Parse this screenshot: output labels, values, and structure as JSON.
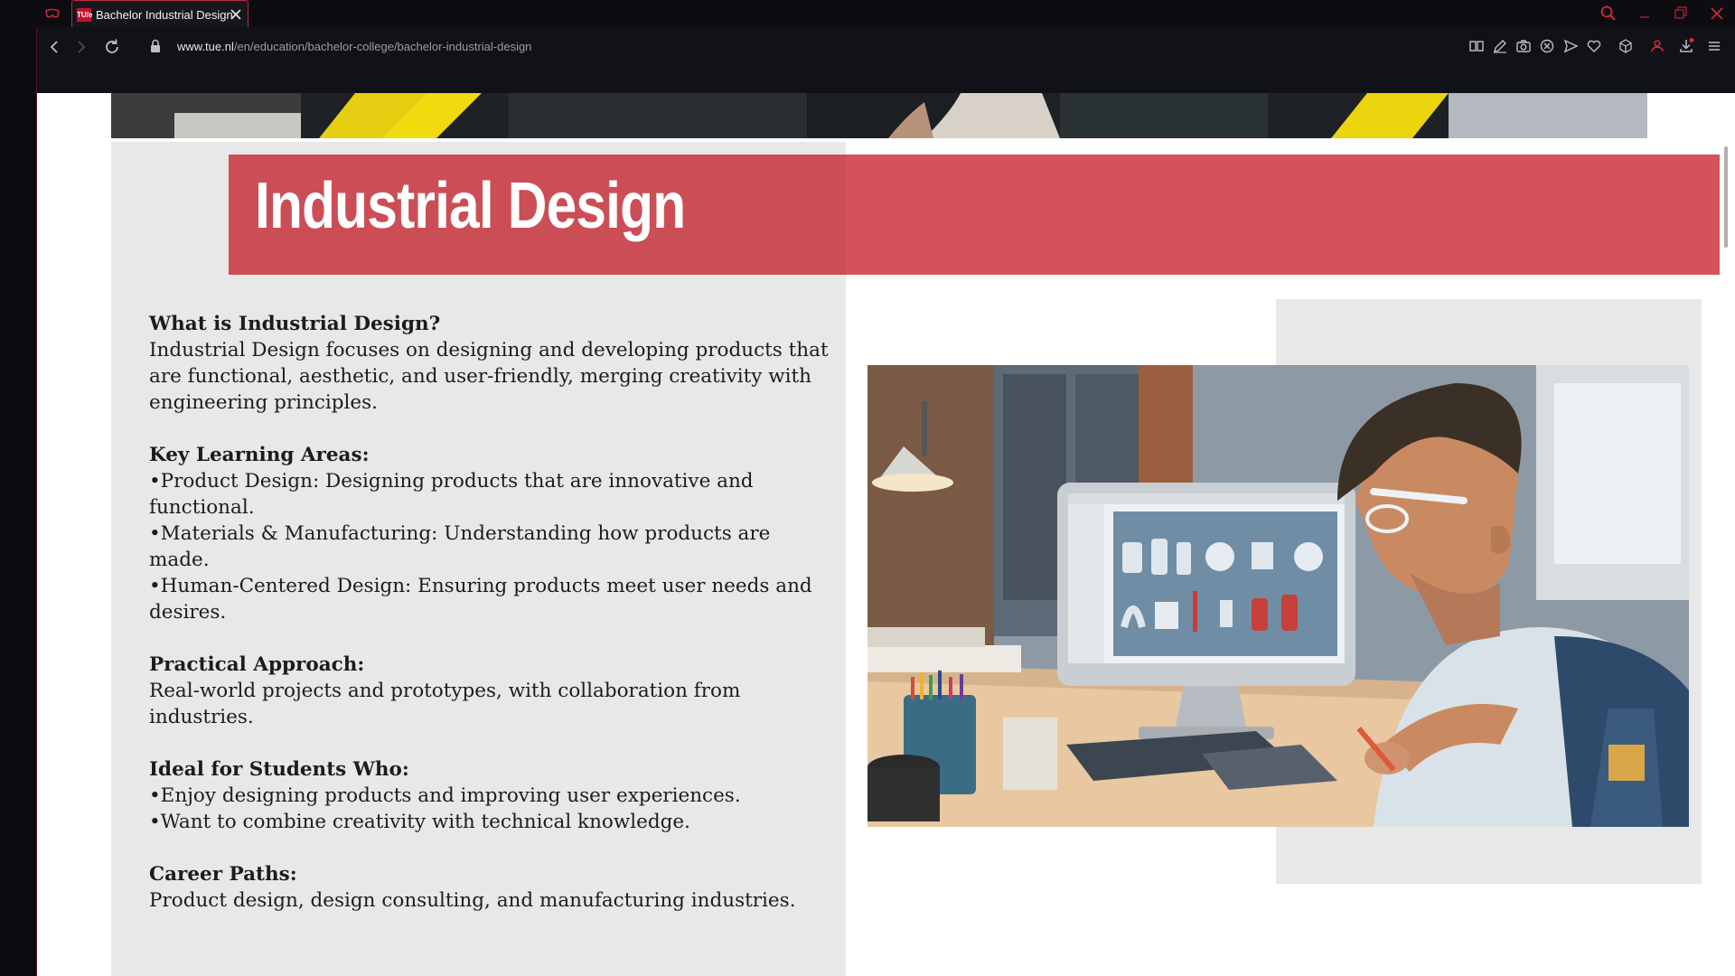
{
  "browser": {
    "tab_title": "Bachelor Industrial Design",
    "favicon_text": "TU/e",
    "url_host": "www.tue.nl",
    "url_path": "/en/education/bachelor-college/bachelor-industrial-design",
    "accent": "#c0283c"
  },
  "page": {
    "title": "Industrial Design",
    "title_band_color": "#d4525a",
    "sections": [
      {
        "heading": "What is Industrial Design?",
        "lines": [
          "Industrial Design focuses on designing and developing products that are functional, aesthetic, and user-friendly, merging creativity with engineering principles."
        ]
      },
      {
        "heading": "Key Learning Areas:",
        "lines": [
          "•Product Design: Designing products that are innovative and functional.",
          "•Materials & Manufacturing: Understanding how products are made.",
          "•Human-Centered Design: Ensuring products meet user needs and desires."
        ]
      },
      {
        "heading": "Practical Approach:",
        "lines": [
          "Real-world projects and prototypes, with collaboration from industries."
        ]
      },
      {
        "heading": "Ideal for Students Who:",
        "lines": [
          "•Enjoy designing products and improving user experiences.",
          "•Want to combine creativity with technical knowledge."
        ]
      },
      {
        "heading": "Career Paths:",
        "lines": [
          "Product design, design consulting, and manufacturing industries."
        ]
      }
    ]
  }
}
